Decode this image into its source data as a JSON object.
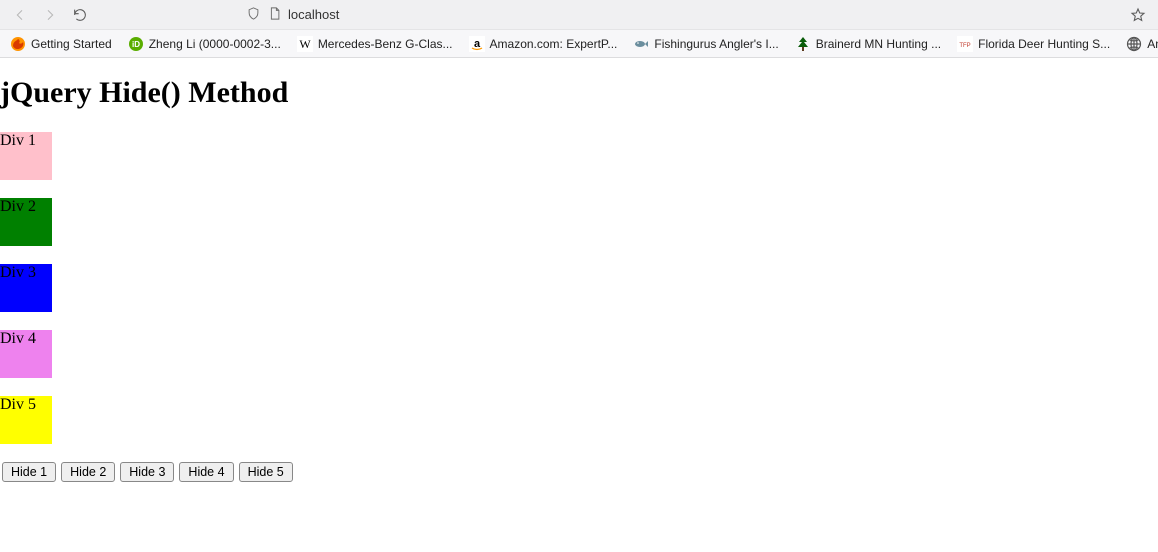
{
  "browser": {
    "url": "localhost",
    "bookmarks": [
      {
        "label": "Getting Started",
        "icon": "firefox"
      },
      {
        "label": "Zheng Li (0000-0002-3...",
        "icon": "orcid"
      },
      {
        "label": "Mercedes-Benz G-Clas...",
        "icon": "wiki"
      },
      {
        "label": "Amazon.com: ExpertP...",
        "icon": "amazon"
      },
      {
        "label": "Fishingurus Angler's I...",
        "icon": "fish"
      },
      {
        "label": "Brainerd MN Hunting ...",
        "icon": "tree"
      },
      {
        "label": "Florida Deer Hunting S...",
        "icon": "tfp"
      },
      {
        "label": "Another res",
        "icon": "globe"
      }
    ]
  },
  "page": {
    "heading": "jQuery Hide() Method",
    "divs": [
      {
        "label": "Div 1",
        "colorClass": "box1"
      },
      {
        "label": "Div 2",
        "colorClass": "box2"
      },
      {
        "label": "Div 3",
        "colorClass": "box3"
      },
      {
        "label": "Div 4",
        "colorClass": "box4"
      },
      {
        "label": "Div 5",
        "colorClass": "box5"
      }
    ],
    "buttons": [
      "Hide 1",
      "Hide 2",
      "Hide 3",
      "Hide 4",
      "Hide 5"
    ]
  }
}
